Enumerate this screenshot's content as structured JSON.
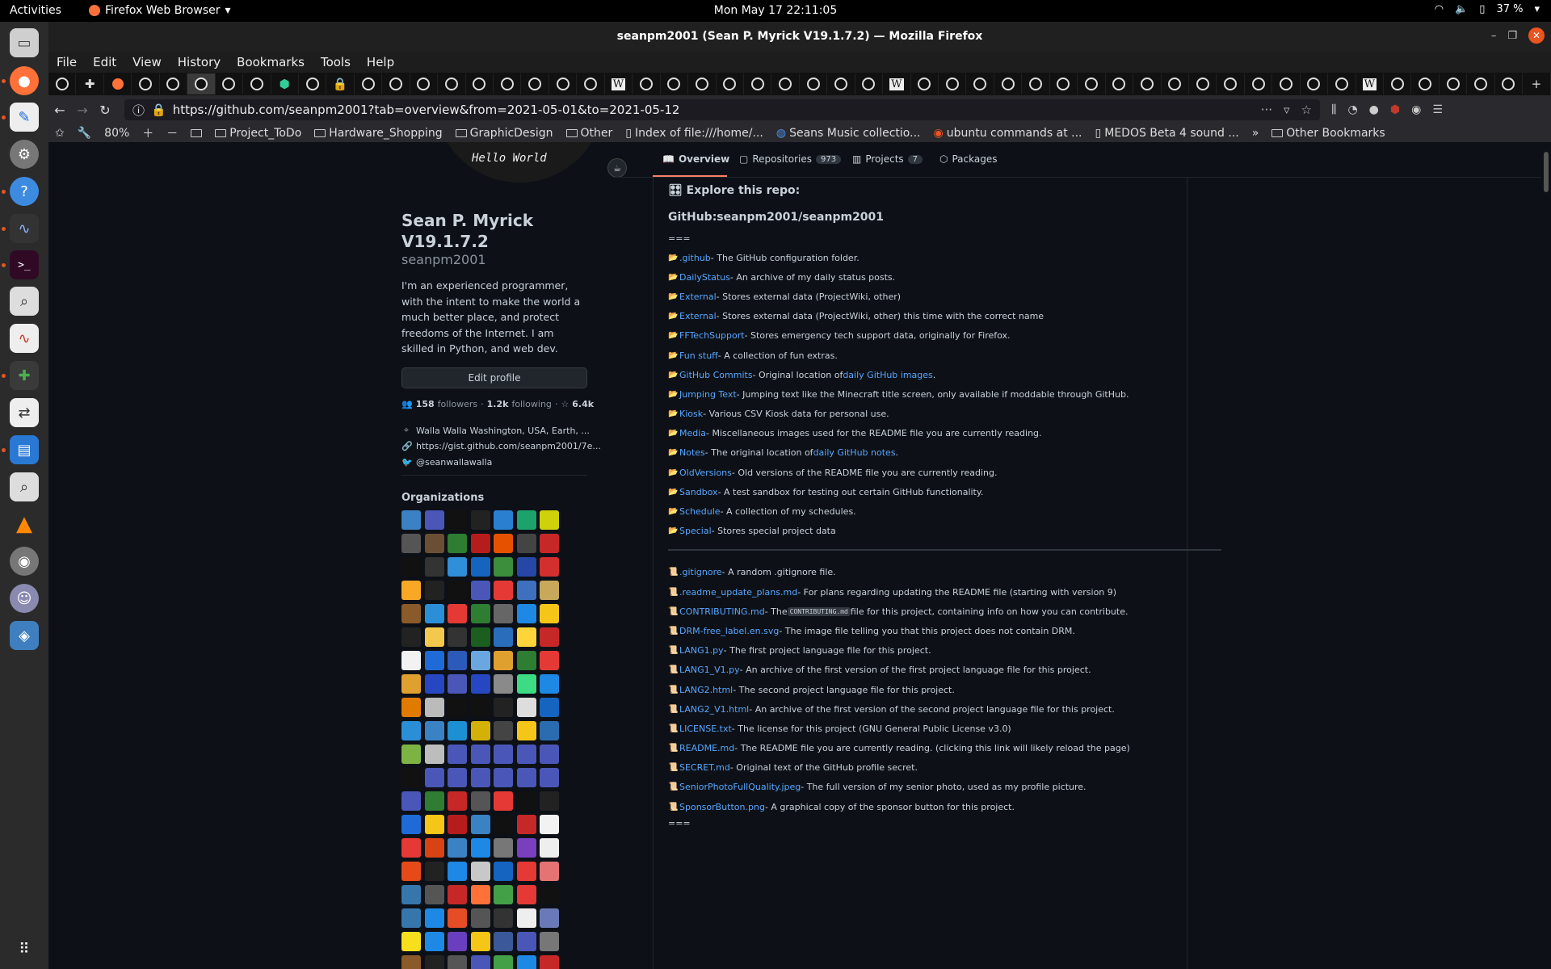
{
  "topbar": {
    "activities": "Activities",
    "app_name": "Firefox Web Browser",
    "clock": "Mon May 17  22:11:05",
    "battery": "37 %"
  },
  "window": {
    "title": "seanpm2001 (Sean P. Myrick V19.1.7.2) — Mozilla Firefox"
  },
  "menu": [
    "File",
    "Edit",
    "View",
    "History",
    "Bookmarks",
    "Tools",
    "Help"
  ],
  "url": "https://github.com/seanpm2001?tab=overview&from=2021-05-01&to=2021-05-12",
  "zoom": "80%",
  "bookmarks": [
    "Project_ToDo",
    "Hardware_Shopping",
    "GraphicDesign",
    "Other",
    "Index of file:///home/...",
    "Seans Music collectio...",
    "ubuntu commands at ...",
    "MEDOS Beta 4 sound ...",
    "Other Bookmarks"
  ],
  "profile": {
    "avatar_text": "Hello World",
    "display_name": "Sean P. Myrick V19.1.7.2",
    "username": "seanpm2001",
    "bio": "I'm an experienced programmer, with the intent to make the world a much better place, and protect freedoms of the Internet. I am skilled in Python, and web dev.",
    "edit_label": "Edit profile",
    "followers_count": "158",
    "followers_label": "followers",
    "following_count": "1.2k",
    "following_label": "following",
    "stars_count": "6.4k",
    "location": "Walla Walla Washington, USA, Earth, ...",
    "website": "https://gist.github.com/seanpm2001/7e...",
    "twitter": "@seanwallawalla",
    "orgs_heading": "Organizations"
  },
  "tabs": [
    {
      "label": "Overview",
      "count": ""
    },
    {
      "label": "Repositories",
      "count": "973"
    },
    {
      "label": "Projects",
      "count": "7"
    },
    {
      "label": "Packages",
      "count": ""
    }
  ],
  "readme": {
    "title": "Explore this repo:",
    "subtitle": "GitHub:seanpm2001/seanpm2001",
    "eq": "===",
    "folders": [
      {
        "name": ".github",
        "desc": " - The GitHub configuration folder."
      },
      {
        "name": "DailyStatus",
        "desc": " - An archive of my daily status posts."
      },
      {
        "name": "External",
        "desc": " - Stores external data (ProjectWiki, other)"
      },
      {
        "name": "External",
        "desc": " - Stores external data (ProjectWiki, other) this time with the correct name"
      },
      {
        "name": "FFTechSupport",
        "desc": " - Stores emergency tech support data, originally for Firefox."
      },
      {
        "name": "Fun stuff",
        "desc": " - A collection of fun extras."
      },
      {
        "name": "GitHub Commits",
        "desc": " - Original location of ",
        "link2": "daily GitHub images",
        "tail": "."
      },
      {
        "name": "Jumping Text",
        "desc": " - Jumping text like the Minecraft title screen, only available if moddable through GitHub."
      },
      {
        "name": "Kiosk",
        "desc": " - Various CSV Kiosk data for personal use."
      },
      {
        "name": "Media",
        "desc": " - Miscellaneous images used for the README file you are currently reading."
      },
      {
        "name": "Notes",
        "desc": " - The original location of ",
        "link2": "daily GitHub notes",
        "tail": "."
      },
      {
        "name": "OldVersions",
        "desc": " - Old versions of the README file you are currently reading."
      },
      {
        "name": "Sandbox",
        "desc": " - A test sandbox for testing out certain GitHub functionality."
      },
      {
        "name": "Schedule",
        "desc": " - A collection of my schedules."
      },
      {
        "name": "Special",
        "desc": " - Stores special project data"
      }
    ],
    "files": [
      {
        "name": ".gitignore",
        "desc": " - A random .gitignore file."
      },
      {
        "name": ".readme_update_plans.md",
        "desc": " - For plans regarding updating the README file (starting with version 9)"
      },
      {
        "name": "CONTRIBUTING.md",
        "desc": " - The ",
        "code": "CONTRIBUTING.md",
        "tail": " file for this project, containing info on how you can contribute."
      },
      {
        "name": "DRM-free_label.en.svg",
        "desc": " - The image file telling you that this project does not contain DRM."
      },
      {
        "name": "LANG1.py",
        "desc": " - The first project language file for this project."
      },
      {
        "name": "LANG1_V1.py",
        "desc": " - An archive of the first version of the first project language file for this project."
      },
      {
        "name": "LANG2.html",
        "desc": " - The second project language file for this project."
      },
      {
        "name": "LANG2_V1.html",
        "desc": " - An archive of the first version of the second project language file for this project."
      },
      {
        "name": "LICENSE.txt",
        "desc": " - The license for this project (GNU General Public License v3.0)"
      },
      {
        "name": "README.md",
        "desc": " - The README file you are currently reading. (clicking this link will likely reload the page)"
      },
      {
        "name": "SECRET.md",
        "desc": " - Original text of the GitHub profile secret."
      },
      {
        "name": "SeniorPhotoFullQuality.jpeg",
        "desc": " - The full version of my senior photo, used as my profile picture."
      },
      {
        "name": "SponsorButton.png",
        "desc": " - A graphical copy of the sponsor button for this project."
      }
    ],
    "eq_end": "==="
  },
  "colors": {
    "bg": "#0d1117",
    "link": "#58a6ff",
    "text": "#c9d1d9",
    "folder": "#e8c24a",
    "accent": "#e95420"
  }
}
